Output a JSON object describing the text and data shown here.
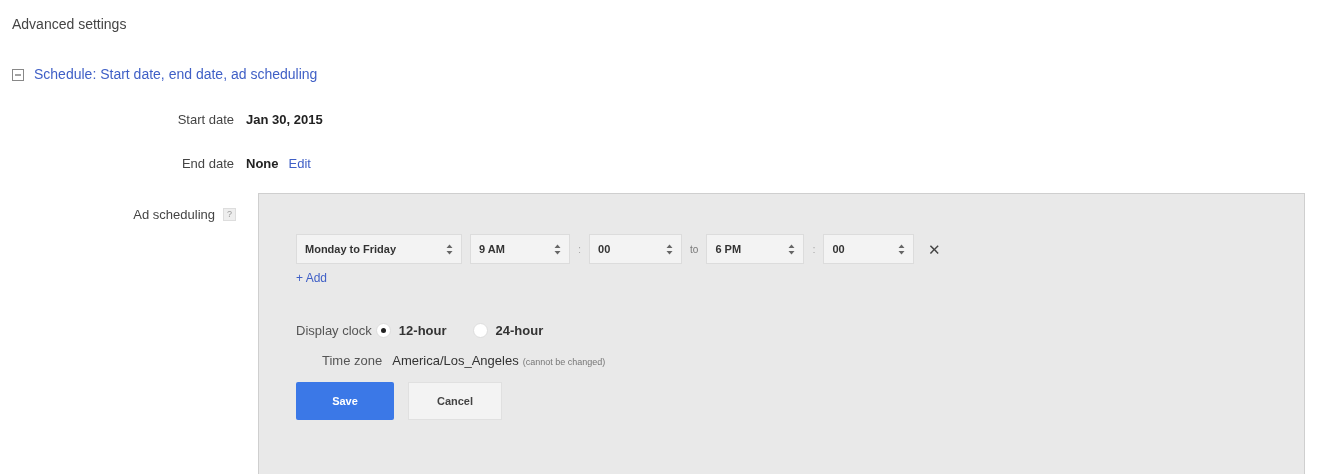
{
  "heading": "Advanced settings",
  "section": {
    "label": "Schedule: Start date, end date, ad scheduling",
    "expanded": true
  },
  "fields": [
    {
      "label": "Start date",
      "value": "Jan 30, 2015"
    },
    {
      "label": "End date",
      "value": "None",
      "link": "Edit"
    }
  ],
  "ad_scheduling": {
    "label": "Ad scheduling",
    "help": "?",
    "rows": [
      {
        "day": "Monday to Friday",
        "start_hour": "9 AM",
        "separator_1": ":",
        "start_minute": "00",
        "to": "to",
        "end_hour": "6 PM",
        "separator_2": ":",
        "end_minute": "00",
        "remove": "✕"
      }
    ],
    "add_link": "+ Add",
    "clock": {
      "label": "Display clock",
      "options": [
        {
          "label": "12-hour",
          "selected": true
        },
        {
          "label": "24-hour",
          "selected": false
        }
      ]
    },
    "time_zone": {
      "label": "Time zone",
      "value": "America/Los_Angeles",
      "note": "(cannot be changed)"
    },
    "buttons": [
      {
        "label": "Save",
        "kind": "primary"
      },
      {
        "label": "Cancel",
        "kind": "secondary"
      }
    ]
  }
}
